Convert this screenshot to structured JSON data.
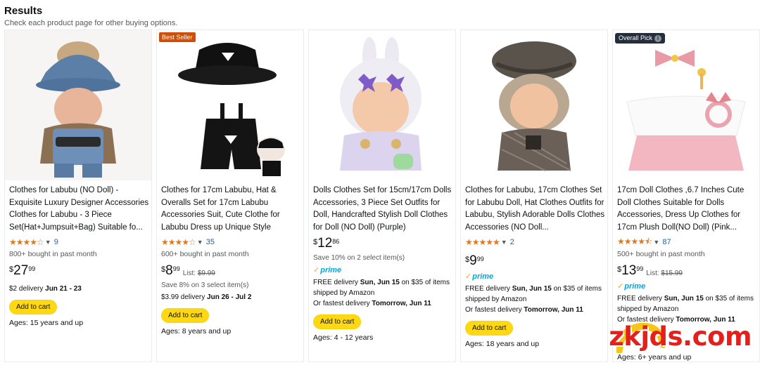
{
  "header": {
    "title": "Results",
    "subtitle": "Check each product page for other buying options."
  },
  "products": [
    {
      "badge": "",
      "title": "Clothes for Labubu (NO Doll) - Exquisite Luxury Designer Accessories Clothes for Labubu - 3 Piece Set(Hat+Jumpsuit+Bag) Suitable fo...",
      "rating": 4.0,
      "stars": "★★★★☆",
      "reviews": "9",
      "bought": "800+ bought in past month",
      "currency": "$",
      "whole": "27",
      "fraction": "99",
      "list_label": "",
      "list_price": "",
      "save": "",
      "prime": false,
      "delivery_1": "$2 delivery ",
      "delivery_1_bold": "Jun 21 - 23",
      "delivery_2": "",
      "delivery_3": "",
      "delivery_3_bold": "",
      "cart": "Add to cart",
      "ages": "Ages: 15 years and up"
    },
    {
      "badge": "Best Seller",
      "title": "Clothes for 17cm Labubu, Hat & Overalls Set for 17cm Labubu Accessories Suit, Cute Clothe for Labubu Dress up Unique Style",
      "rating": 4.0,
      "stars": "★★★★☆",
      "reviews": "35",
      "bought": "600+ bought in past month",
      "currency": "$",
      "whole": "8",
      "fraction": "99",
      "list_label": "List: ",
      "list_price": "$9.99",
      "save": "Save 8% on 3 select item(s)",
      "prime": false,
      "delivery_1": "$3.99 delivery ",
      "delivery_1_bold": "Jun 26 - Jul 2",
      "delivery_2": "",
      "delivery_3": "",
      "delivery_3_bold": "",
      "cart": "Add to cart",
      "ages": "Ages: 8 years and up"
    },
    {
      "badge": "",
      "title": "Dolls Clothes Set for 15cm/17cm Dolls Accessories, 3 Piece Set Outfits for Doll, Handcrafted Stylish Doll Clothes for Doll (NO Doll) (Purple)",
      "rating": null,
      "stars": "",
      "reviews": "",
      "bought": "",
      "currency": "$",
      "whole": "12",
      "fraction": "86",
      "list_label": "",
      "list_price": "",
      "save": "Save 10% on 2 select item(s)",
      "prime": true,
      "delivery_1": "FREE delivery ",
      "delivery_1_bold": "Sun, Jun 15",
      "delivery_1_tail": " on $35 of items shipped by Amazon",
      "delivery_3": "Or fastest delivery ",
      "delivery_3_bold": "Tomorrow, Jun 11",
      "cart": "Add to cart",
      "ages": "Ages: 4 - 12 years"
    },
    {
      "badge": "",
      "title": "Clothes for Labubu, 17cm Clothes Set for Labubu Doll, Hat Clothes Outfits for Labubu, Stylish Adorable Dolls Clothes Accessories (NO Doll...",
      "rating": 5.0,
      "stars": "★★★★★",
      "reviews": "2",
      "bought": "",
      "currency": "$",
      "whole": "9",
      "fraction": "99",
      "list_label": "",
      "list_price": "",
      "save": "",
      "prime": true,
      "delivery_1": "FREE delivery ",
      "delivery_1_bold": "Sun, Jun 15",
      "delivery_1_tail": " on $35 of items shipped by Amazon",
      "delivery_3": "Or fastest delivery ",
      "delivery_3_bold": "Tomorrow, Jun 11",
      "cart": "Add to cart",
      "ages": "Ages: 18 years and up"
    },
    {
      "badge": "Overall Pick",
      "title": "17cm Doll Clothes ,6.7 Inches Cute Doll Clothes Suitable for Dolls Accessories, Dress Up Clothes for 17cm Plush Doll(NO Doll) (Pink...",
      "rating": 4.5,
      "stars": "★★★★⯪",
      "reviews": "87",
      "bought": "500+ bought in past month",
      "currency": "$",
      "whole": "13",
      "fraction": "99",
      "list_label": "List: ",
      "list_price": "$15.99",
      "save": "",
      "prime": true,
      "delivery_1": "FREE delivery ",
      "delivery_1_bold": "Sun, Jun 15",
      "delivery_1_tail": " on $35 of items shipped by Amazon",
      "delivery_3": "Or fastest delivery ",
      "delivery_3_bold": "Tomorrow, Jun 11",
      "cart": "Add to cart",
      "ages": "Ages: 6+ years and up"
    }
  ],
  "prime_label": "prime",
  "info_glyph": "i",
  "watermark": "zkjds.com",
  "colors": {
    "star": "#de7921",
    "link": "#2162a1",
    "cart": "#ffd814",
    "best_seller": "#cc4f0b",
    "overall_pick": "#232f3e",
    "prime": "#00a8e1",
    "watermark": "#e3201b"
  }
}
